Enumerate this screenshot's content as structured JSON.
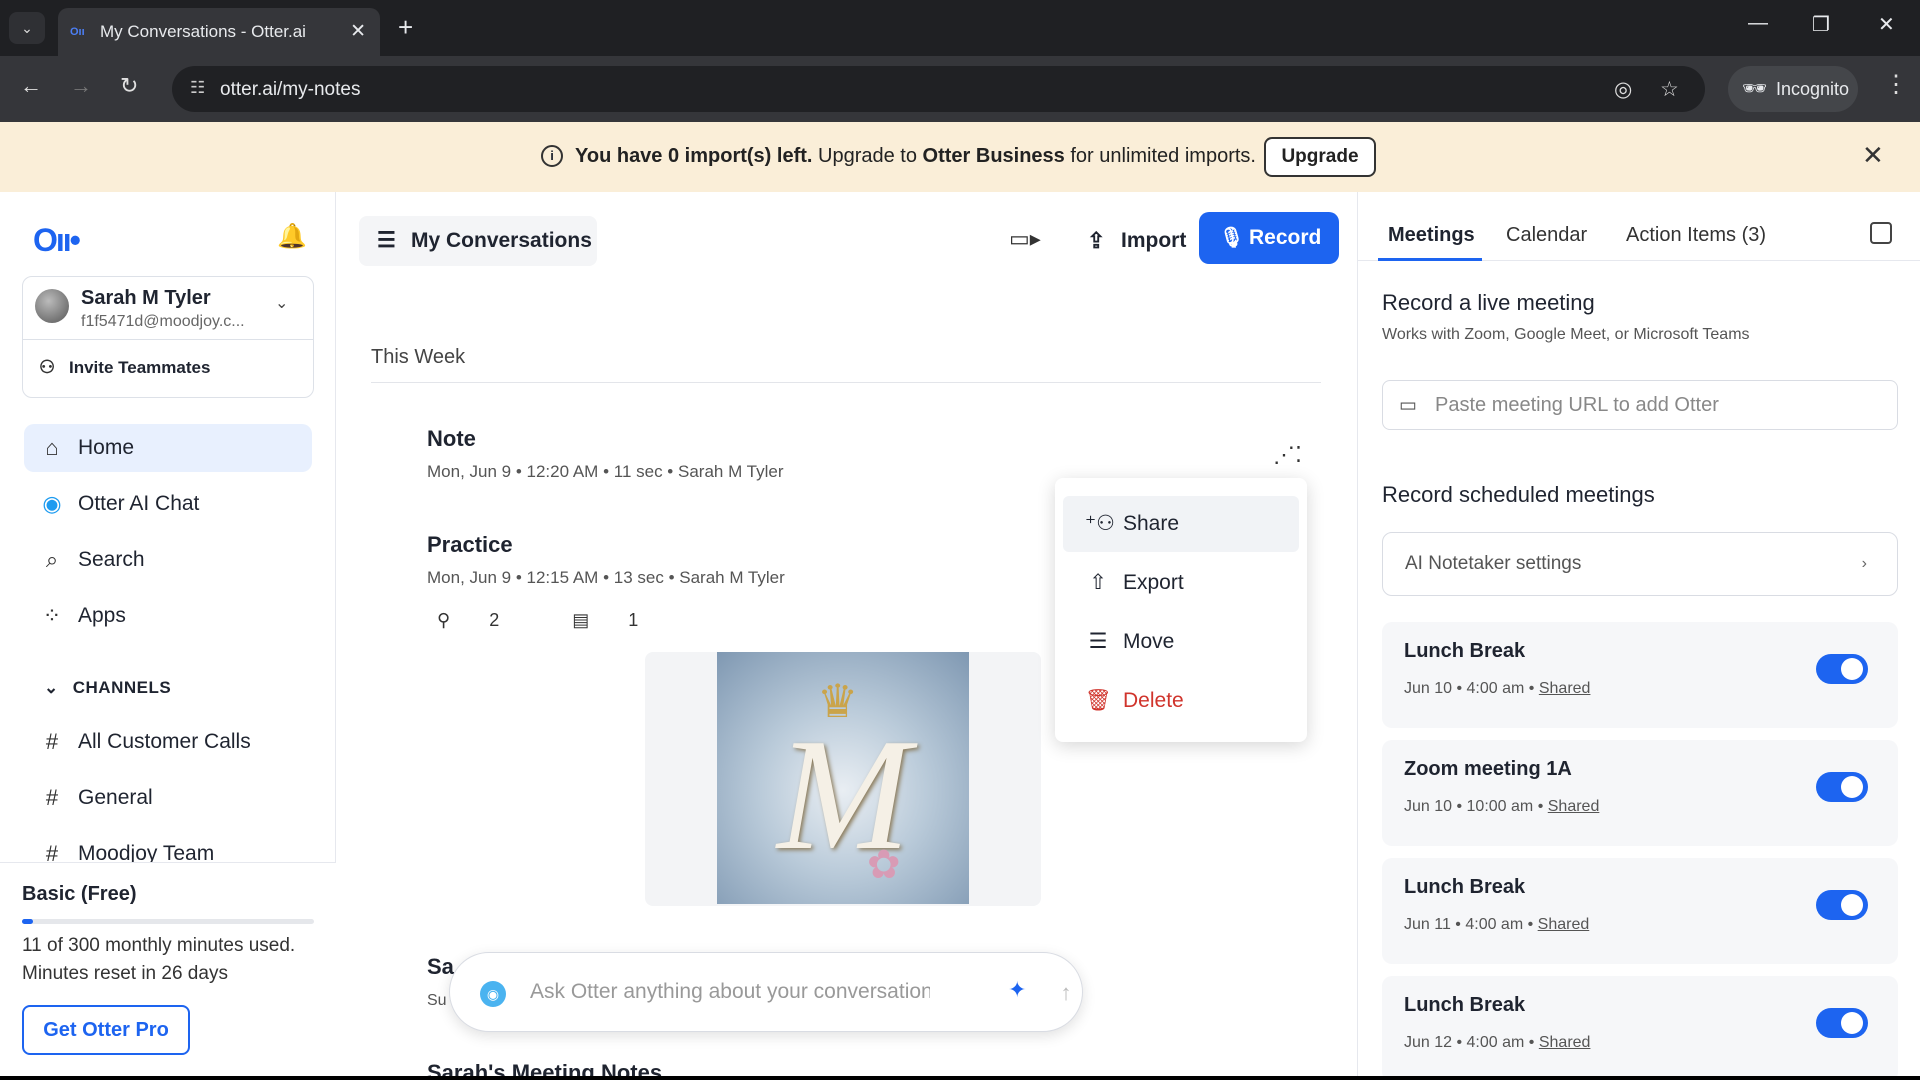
{
  "browser": {
    "tab_title": "My Conversations - Otter.ai",
    "url": "otter.ai/my-notes",
    "incognito_label": "Incognito"
  },
  "banner": {
    "text_bold": "You have 0 import(s) left.",
    "text_mid": " Upgrade to ",
    "text_brand": "Otter Business",
    "text_end": " for unlimited imports.",
    "upgrade_label": "Upgrade"
  },
  "sidebar": {
    "user_name": "Sarah M Tyler",
    "user_email": "f1f5471d@moodjoy.c...",
    "invite_label": "Invite Teammates",
    "nav": [
      {
        "label": "Home",
        "icon": "home-icon"
      },
      {
        "label": "Otter AI Chat",
        "icon": "otter-chat-icon"
      },
      {
        "label": "Search",
        "icon": "search-icon"
      },
      {
        "label": "Apps",
        "icon": "apps-icon"
      }
    ],
    "channels_header": "CHANNELS",
    "channels": [
      "All Customer Calls",
      "General",
      "Moodjoy Team"
    ],
    "plan_name": "Basic (Free)",
    "minutes_used": "11 of 300 monthly minutes used.",
    "minutes_used_fraction": 0.037,
    "minutes_reset": "Minutes reset in 26 days",
    "get_pro_label": "Get Otter Pro"
  },
  "main": {
    "header_title": "My Conversations",
    "import_label": "Import",
    "record_label": "Record",
    "week_header": "This Week",
    "conversations": [
      {
        "title": "Note",
        "date": "Mon, Jun 9",
        "time": "12:20 AM",
        "duration": "11 sec",
        "owner": "Sarah M Tyler"
      },
      {
        "title": "Practice",
        "date": "Mon, Jun 9",
        "time": "12:15 AM",
        "duration": "13 sec",
        "owner": "Sarah M Tyler",
        "speakers": "2",
        "comments": "1"
      }
    ],
    "partial_title": "Sa",
    "partial_sub": "Su",
    "last_title": "Sarah's Meeting Notes",
    "ask_placeholder": "Ask Otter anything about your conversations...",
    "menu": [
      "Share",
      "Export",
      "Move",
      "Delete"
    ]
  },
  "right_panel": {
    "tabs": [
      "Meetings",
      "Calendar",
      "Action Items (3)"
    ],
    "live_title": "Record a live meeting",
    "live_sub": "Works with Zoom, Google Meet, or Microsoft Teams",
    "url_placeholder": "Paste meeting URL to add Otter",
    "scheduled_title": "Record scheduled meetings",
    "notetaker_label": "AI Notetaker settings",
    "meetings": [
      {
        "title": "Lunch Break",
        "when": "Jun 10 • 4:00 am",
        "shared": "Shared",
        "enabled": true
      },
      {
        "title": "Zoom meeting 1A",
        "when": "Jun 10 • 10:00 am",
        "shared": "Shared",
        "enabled": true
      },
      {
        "title": "Lunch Break",
        "when": "Jun 11 • 4:00 am",
        "shared": "Shared",
        "enabled": true
      },
      {
        "title": "Lunch Break",
        "when": "Jun 12 • 4:00 am",
        "shared": "Shared",
        "enabled": true
      }
    ]
  },
  "colors": {
    "accent": "#1d64f0",
    "banner_bg": "#faeed8",
    "danger": "#d0342c"
  }
}
